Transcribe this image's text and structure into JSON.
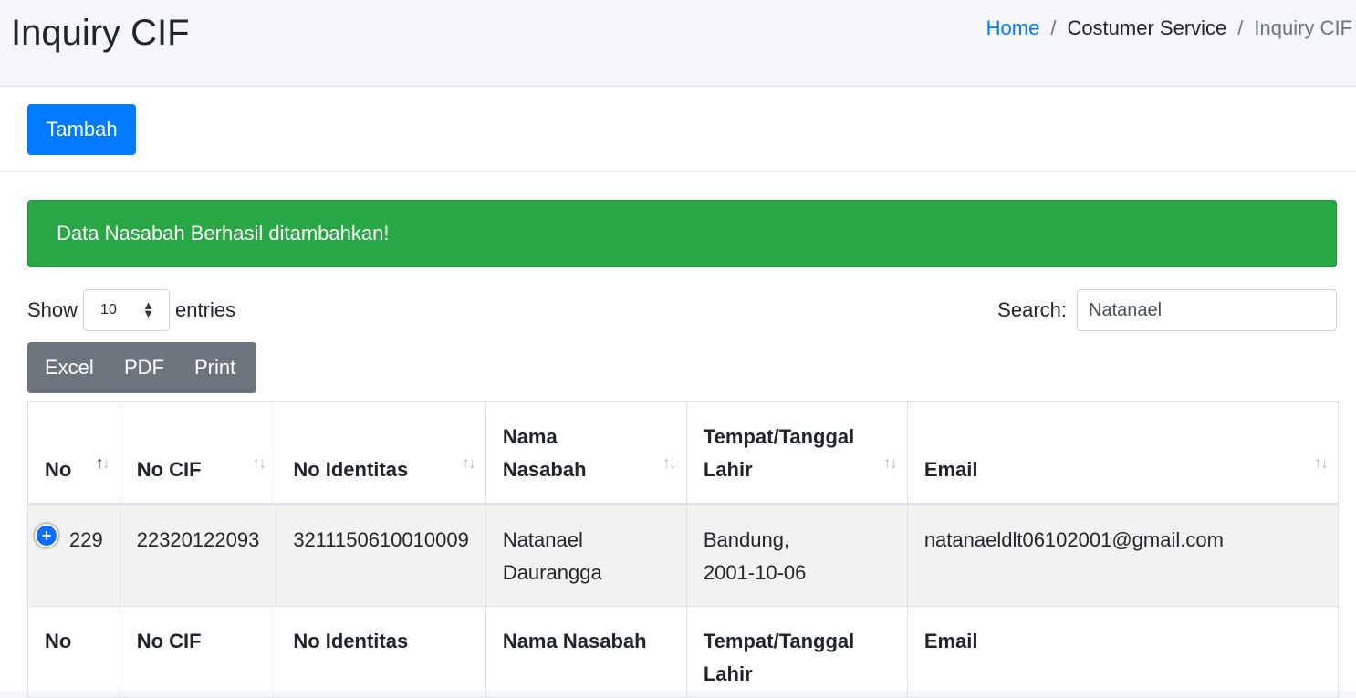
{
  "header": {
    "title": "Inquiry CIF",
    "breadcrumb": [
      {
        "label": "Home"
      },
      {
        "label": "Costumer Service"
      },
      {
        "label": "Inquiry CIF"
      }
    ]
  },
  "toolbar": {
    "add_label": "Tambah"
  },
  "alert": {
    "message": "Data Nasabah Berhasil ditambahkan!"
  },
  "length": {
    "show_label": "Show",
    "value": "10",
    "entries_label": "entries"
  },
  "search": {
    "label": "Search:",
    "value": "Natanael"
  },
  "export_buttons": {
    "excel": "Excel",
    "pdf": "PDF",
    "print": "Print"
  },
  "table": {
    "headers": {
      "no": "No",
      "no_cif": "No CIF",
      "no_identitas": "No Identitas",
      "nama_nasabah_1": "Nama",
      "nama_nasabah_2": "Nasabah",
      "ttl_1": "Tempat/Tanggal",
      "ttl_2": "Lahir",
      "email": "Email"
    },
    "rows": [
      {
        "no": "229",
        "no_cif": "22320122093",
        "no_identitas": "3211150610010009",
        "nama_1": "Natanael",
        "nama_2": "Daurangga",
        "ttl_1": "Bandung,",
        "ttl_2": "2001-10-06",
        "email": "natanaeldlt06102001@gmail.com"
      }
    ],
    "footers": {
      "no": "No",
      "no_cif": "No CIF",
      "no_identitas": "No Identitas",
      "nama_nasabah": "Nama Nasabah",
      "ttl_1": "Tempat/Tanggal",
      "ttl_2": "Lahir",
      "email": "Email"
    }
  },
  "colors": {
    "primary": "#007bff",
    "success": "#28a745",
    "secondary": "#6c757d"
  }
}
